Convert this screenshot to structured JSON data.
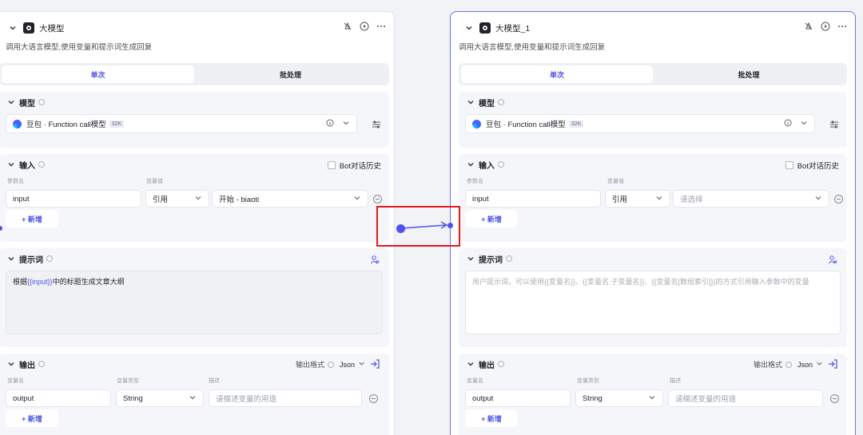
{
  "nodes": [
    {
      "title": "大模型",
      "description": "调用大语言模型,使用变量和提示词生成回复",
      "tabs": [
        "单次",
        "批处理"
      ],
      "model_section_title": "模型",
      "model_name": "豆包 · Function call模型",
      "model_badge": "32K",
      "input_section_title": "输入",
      "bot_history_label": "Bot对话历史",
      "param_name_label": "参数名",
      "param_value_label": "变量值",
      "input_name": "input",
      "input_type": "引用",
      "input_value": "开始 - biaoti",
      "add_label": "+ 新增",
      "prompt_section_title": "提示词",
      "prompt_prefix": "根据",
      "prompt_var": "{{input}}",
      "prompt_suffix": "中的标题生成文章大纲",
      "output_section_title": "输出",
      "output_format_label": "输出格式",
      "output_format_value": "Json",
      "var_name_label": "变量名",
      "var_type_label": "变量类型",
      "desc_label": "描述",
      "output_name": "output",
      "output_type": "String",
      "output_desc_placeholder": "请描述变量的用途"
    },
    {
      "title": "大模型_1",
      "description": "调用大语言模型,使用变量和提示词生成回复",
      "tabs": [
        "单次",
        "批处理"
      ],
      "model_section_title": "模型",
      "model_name": "豆包 · Function call模型",
      "model_badge": "32K",
      "input_section_title": "输入",
      "bot_history_label": "Bot对话历史",
      "param_name_label": "参数名",
      "param_value_label": "变量值",
      "input_name": "input",
      "input_type": "引用",
      "input_value": "请选择",
      "add_label": "+ 新增",
      "prompt_section_title": "提示词",
      "prompt_placeholder": "用户提示词，可以使用{{变量名}}、{{变量名.子变量名}}、{{变量名[数组索引]}}的方式引用输入参数中的变量",
      "output_section_title": "输出",
      "output_format_label": "输出格式",
      "output_format_value": "Json",
      "var_name_label": "变量名",
      "var_type_label": "变量类型",
      "desc_label": "描述",
      "output_name": "output",
      "output_type": "String",
      "output_desc_placeholder": "请描述变量的用途"
    }
  ],
  "colors": {
    "accent": "#4d53e8",
    "selected_border": "#6c70f5",
    "highlight": "#e01919"
  }
}
